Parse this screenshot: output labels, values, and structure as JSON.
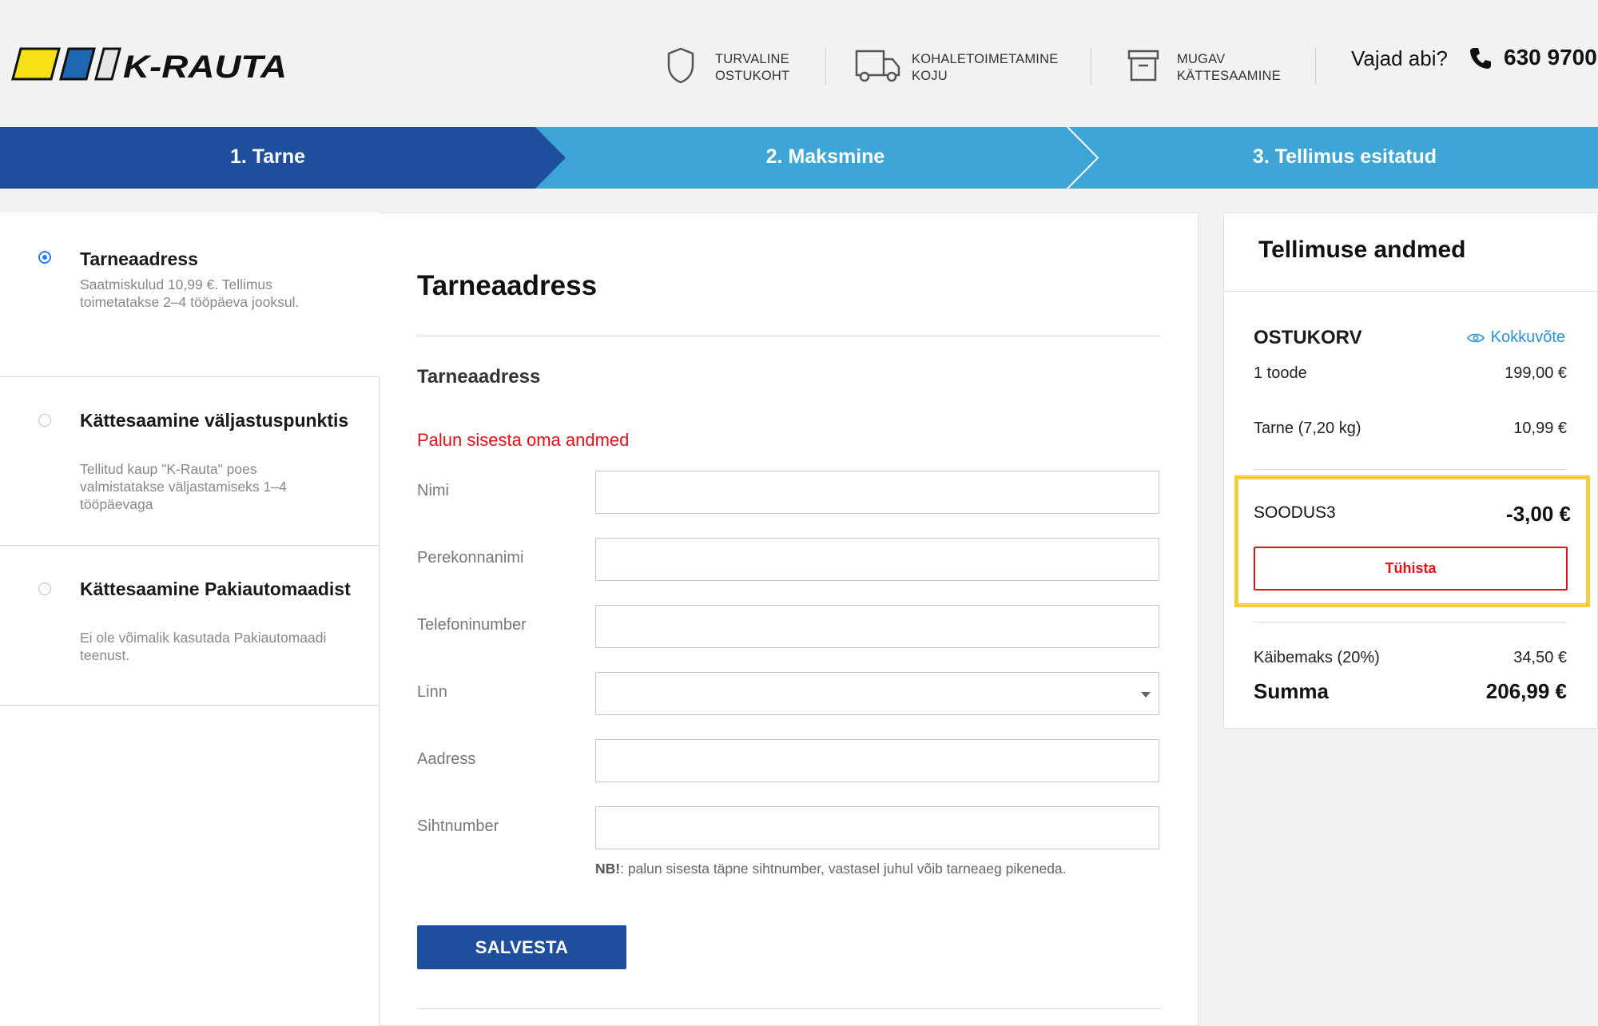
{
  "header": {
    "brand": "K-RAUTA",
    "brand_colors": [
      "#f7e017",
      "#1f66b3",
      "#e6e6e6"
    ],
    "features": [
      {
        "icon": "shield-icon",
        "line1": "TURVALINE",
        "line2": "OSTUKOHT"
      },
      {
        "icon": "delivery-truck-icon",
        "line1": "KOHALETOIMETAMINE",
        "line2": "KOJU"
      },
      {
        "icon": "box-icon",
        "line1": "MUGAV",
        "line2": "KÄTTESAAMINE"
      }
    ],
    "help_label": "Vajad abi?",
    "phone_icon": "phone-icon",
    "phone": "630 9700"
  },
  "steps": [
    {
      "label": "1. Tarne",
      "active": true
    },
    {
      "label": "2. Maksmine",
      "active": false
    },
    {
      "label": "3. Tellimus esitatud",
      "active": false
    }
  ],
  "step_colors": {
    "active": "#1f4f9c",
    "inactive": "#3ea6d6"
  },
  "delivery_methods": [
    {
      "title": "Tarneaadress",
      "desc": "Saatmiskulud 10,99 €. Tellimus toimetatakse 2–4 tööpäeva jooksul.",
      "selected": true
    },
    {
      "title": "Kättesaamine väljastuspunktis",
      "desc": "Tellitud kaup \"K-Rauta\" poes valmistatakse väljastamiseks 1–4 tööpäevaga",
      "selected": false
    },
    {
      "title": "Kättesaamine Pakiautomaadist",
      "desc": "Ei ole võimalik kasutada Pakiautomaadi teenust.",
      "selected": false
    }
  ],
  "form": {
    "title": "Tarneaadress",
    "subtitle": "Tarneaadress",
    "warning": "Palun sisesta oma andmed",
    "warning_color": "#e3101a",
    "fields": [
      {
        "label": "Nimi",
        "value": "",
        "type": "text"
      },
      {
        "label": "Perekonnanimi",
        "value": "",
        "type": "text"
      },
      {
        "label": "Telefoninumber",
        "value": "",
        "type": "text"
      },
      {
        "label": "Linn",
        "value": "",
        "type": "select"
      },
      {
        "label": "Aadress",
        "value": "",
        "type": "text"
      },
      {
        "label": "Sihtnumber",
        "value": "",
        "type": "text"
      }
    ],
    "note_prefix": "NB!",
    "note_text": ": palun sisesta täpne sihtnumber, vastasel juhul võib tarneaeg pikeneda.",
    "save_label": "SALVESTA"
  },
  "summary": {
    "title": "Tellimuse andmed",
    "cart_heading": "OSTUKORV",
    "summary_link": "Kokkuvõte",
    "summary_link_icon": "eye-icon",
    "items_label": "1 toode",
    "items_price": "199,00 €",
    "shipping_label": "Tarne (7,20 kg)",
    "shipping_price": "10,99 €",
    "promo_code": "SOODUS3",
    "promo_value": "-3,00 €",
    "promo_highlight": "#f7cc38",
    "cancel_label": "Tühista",
    "vat_label": "Käibemaks (20%)",
    "vat_value": "34,50 €",
    "total_label": "Summa",
    "total_value": "206,99 €"
  }
}
